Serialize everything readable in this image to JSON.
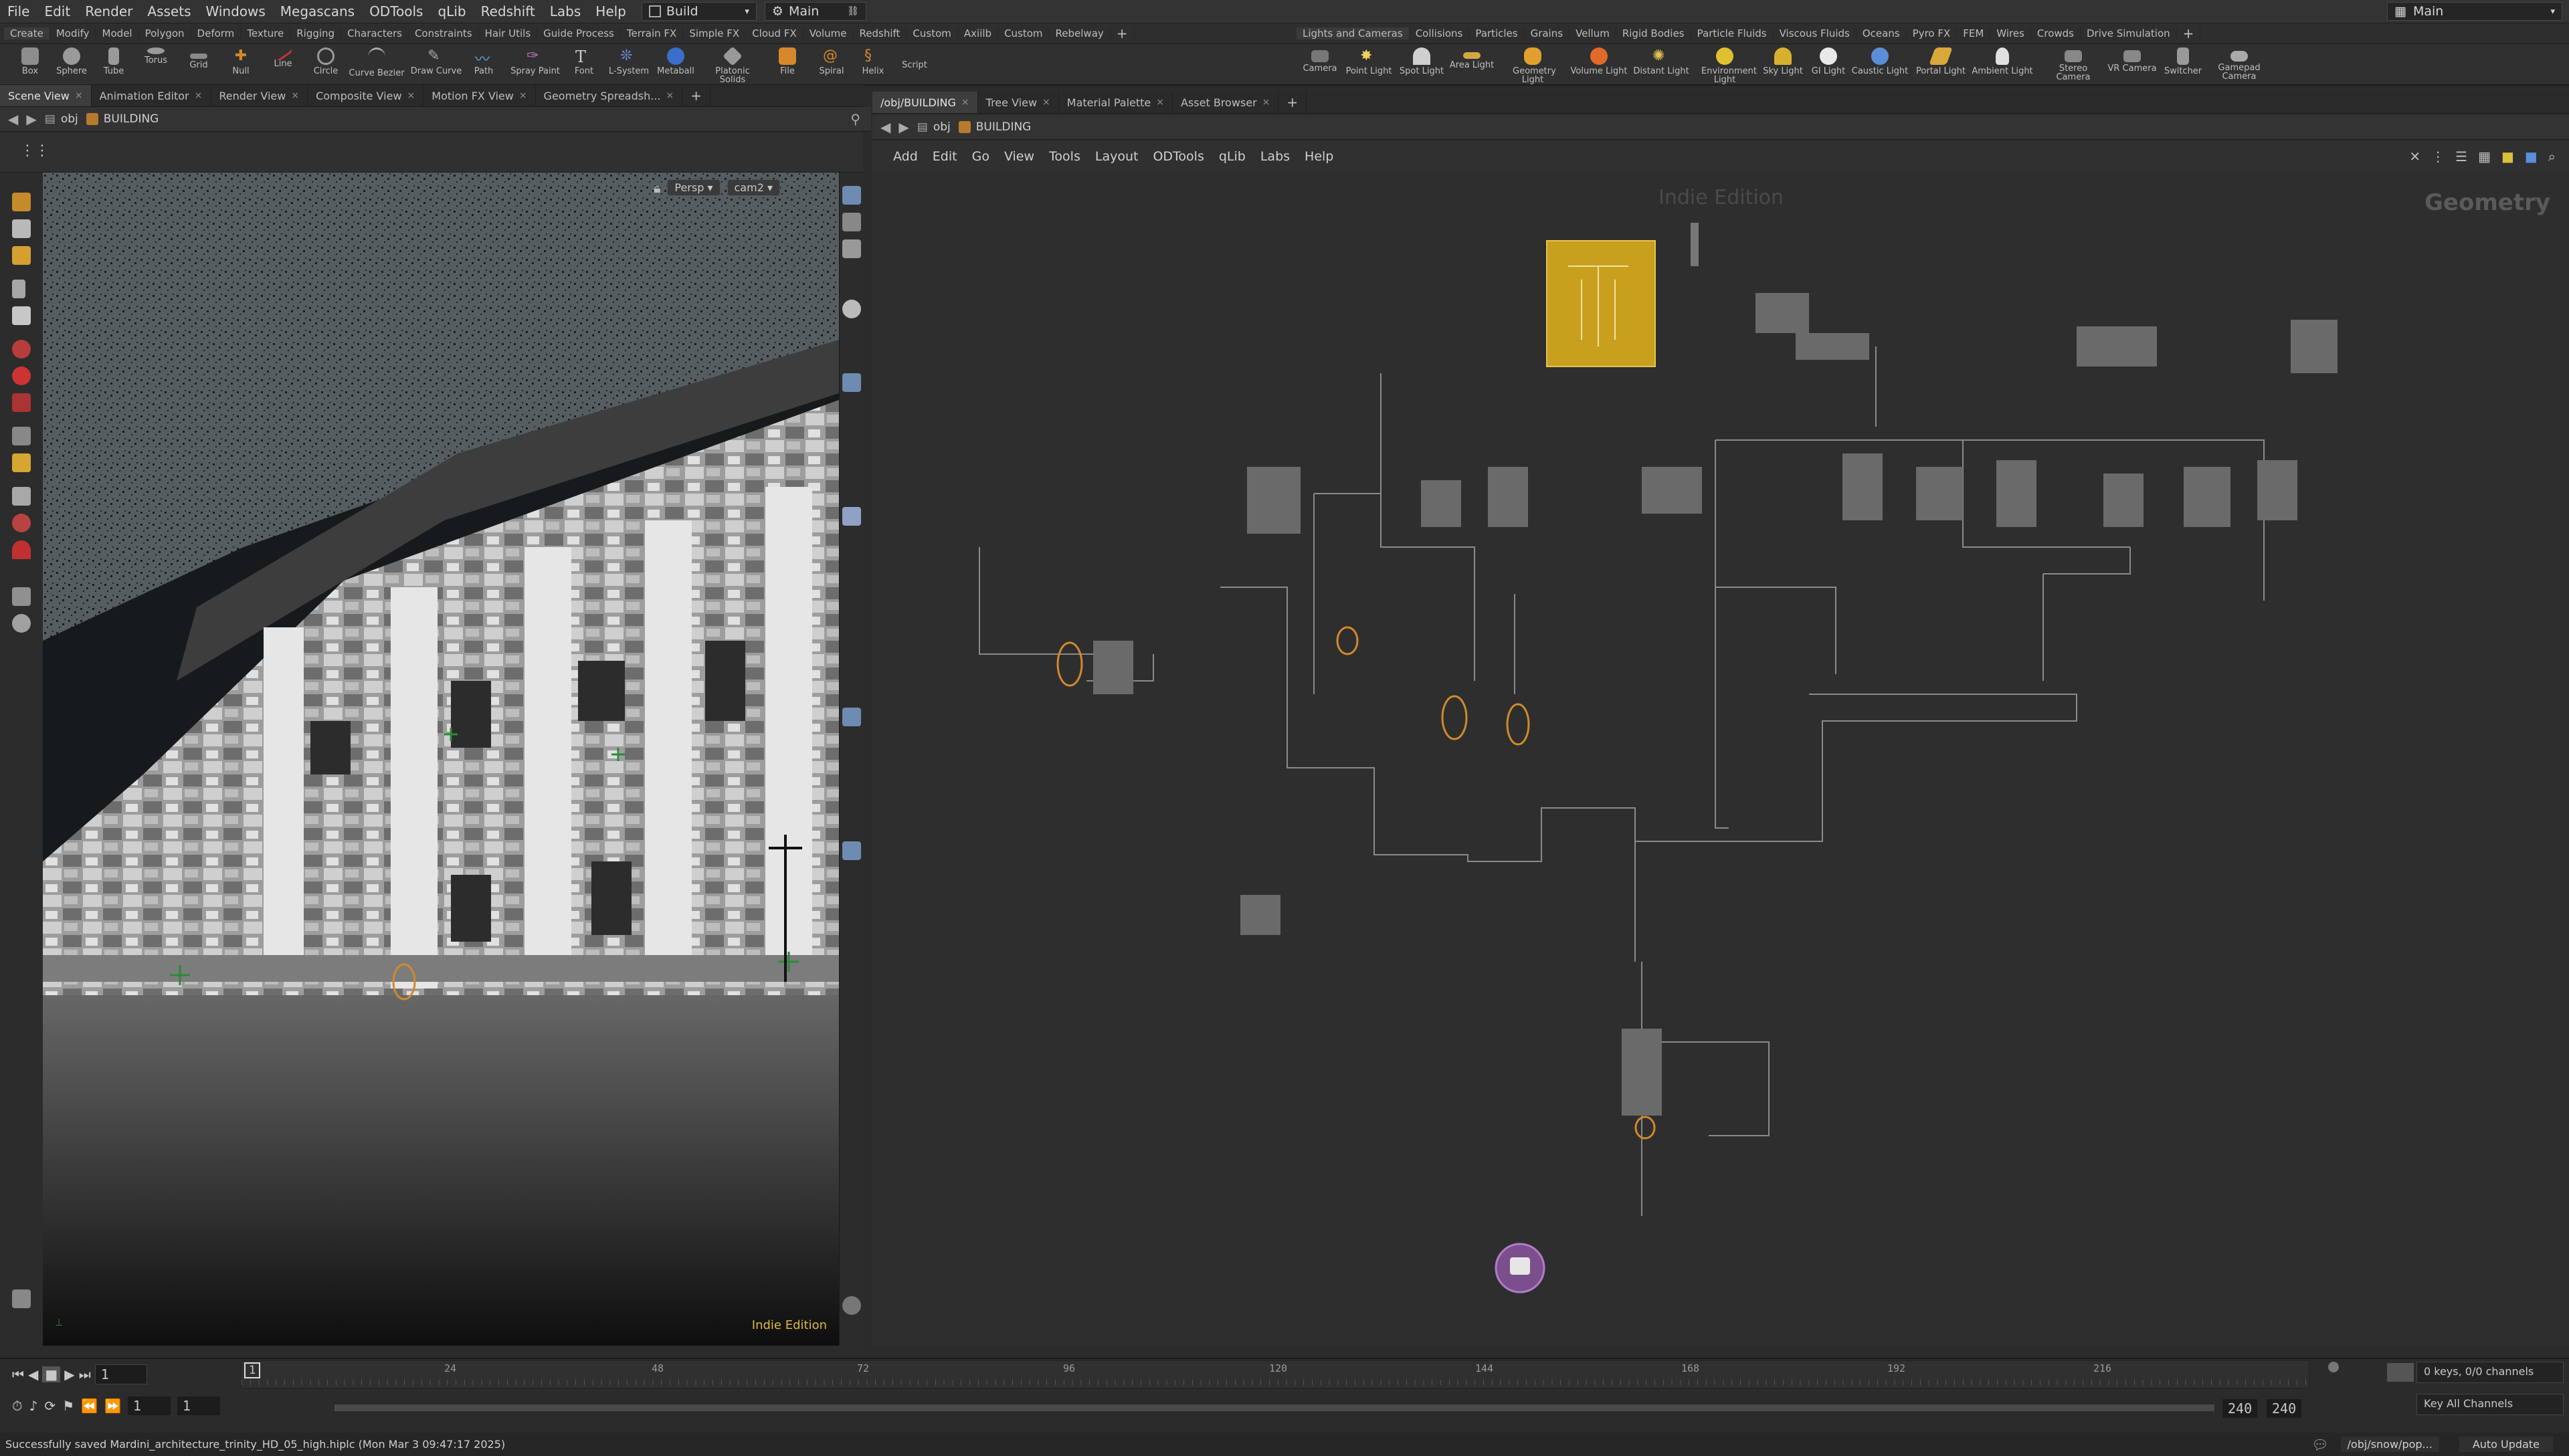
{
  "menubar": {
    "items": [
      "File",
      "Edit",
      "Render",
      "Assets",
      "Windows",
      "Megascans",
      "ODTools",
      "qLib",
      "Redshift",
      "Labs",
      "Help"
    ],
    "desktop_label": "Build",
    "context_label": "Main",
    "right_label": "Main"
  },
  "shelf": {
    "left_tabs": [
      "Create",
      "Modify",
      "Model",
      "Polygon",
      "Deform",
      "Texture",
      "Rigging",
      "Characters",
      "Constraints",
      "Hair Utils",
      "Guide Process",
      "Terrain FX",
      "Simple FX",
      "Cloud FX",
      "Volume",
      "Redshift",
      "Custom",
      "Axiilb",
      "Custom",
      "Rebelway"
    ],
    "right_tabs": [
      "Lights and Cameras",
      "Collisions",
      "Particles",
      "Grains",
      "Vellum",
      "Rigid Bodies",
      "Particle Fluids",
      "Viscous Fluids",
      "Oceans",
      "Pyro FX",
      "FEM",
      "Wires",
      "Crowds",
      "Drive Simulation"
    ],
    "left_tools": [
      "Box",
      "Sphere",
      "Tube",
      "Torus",
      "Grid",
      "Null",
      "Line",
      "Circle",
      "Curve Bezier",
      "Draw Curve",
      "Path",
      "Spray Paint",
      "Font",
      "L-System",
      "Metaball",
      "Platonic Solids",
      "File",
      "Spiral",
      "Helix",
      "Script"
    ],
    "right_tools": [
      "Camera",
      "Point Light",
      "Spot Light",
      "Area Light",
      "Geometry Light",
      "Volume Light",
      "Distant Light",
      "Environment Light",
      "Sky Light",
      "GI Light",
      "Caustic Light",
      "Portal Light",
      "Ambient Light",
      "Stereo Camera",
      "VR Camera",
      "Switcher",
      "Gamepad Camera"
    ]
  },
  "left_pane": {
    "tabs": [
      "Scene View",
      "Animation Editor",
      "Render View",
      "Composite View",
      "Motion FX View",
      "Geometry Spreadsh..."
    ],
    "path_obj": "obj",
    "path_node": "BUILDING",
    "view_persp": "Persp",
    "view_cam": "cam2",
    "watermark": "Indie Edition"
  },
  "right_pane": {
    "tabs": [
      "/obj/BUILDING",
      "Tree View",
      "Material Palette",
      "Asset Browser"
    ],
    "path_obj": "obj",
    "path_node": "BUILDING",
    "menu": [
      "Add",
      "Edit",
      "Go",
      "View",
      "Tools",
      "Layout",
      "ODTools",
      "qLib",
      "Labs",
      "Help"
    ],
    "watermark": "Indie Edition",
    "context_label": "Geometry"
  },
  "timeline": {
    "current_frame": "1",
    "marker_frame": "1",
    "ticks": [
      "24",
      "48",
      "72",
      "96",
      "120",
      "144",
      "168",
      "192",
      "216"
    ],
    "start_frame": "1",
    "start_frame2": "1",
    "end_frame": "240",
    "end_frame2": "240",
    "keys_info": "0 keys, 0/0 channels",
    "key_all_label": "Key All Channels"
  },
  "status": {
    "message": "Successfully saved Mardini_architecture_trinity_HD_05_high.hiplc (Mon Mar 3 09:47:17 2025)",
    "path": "/obj/snow/pop...",
    "update_mode": "Auto Update"
  },
  "colors": {
    "accent_orange": "#d49a2c",
    "selected_node": "#c8a01e",
    "output_node": "#7a4f8c",
    "watermark_yellow": "#e0b83a"
  }
}
